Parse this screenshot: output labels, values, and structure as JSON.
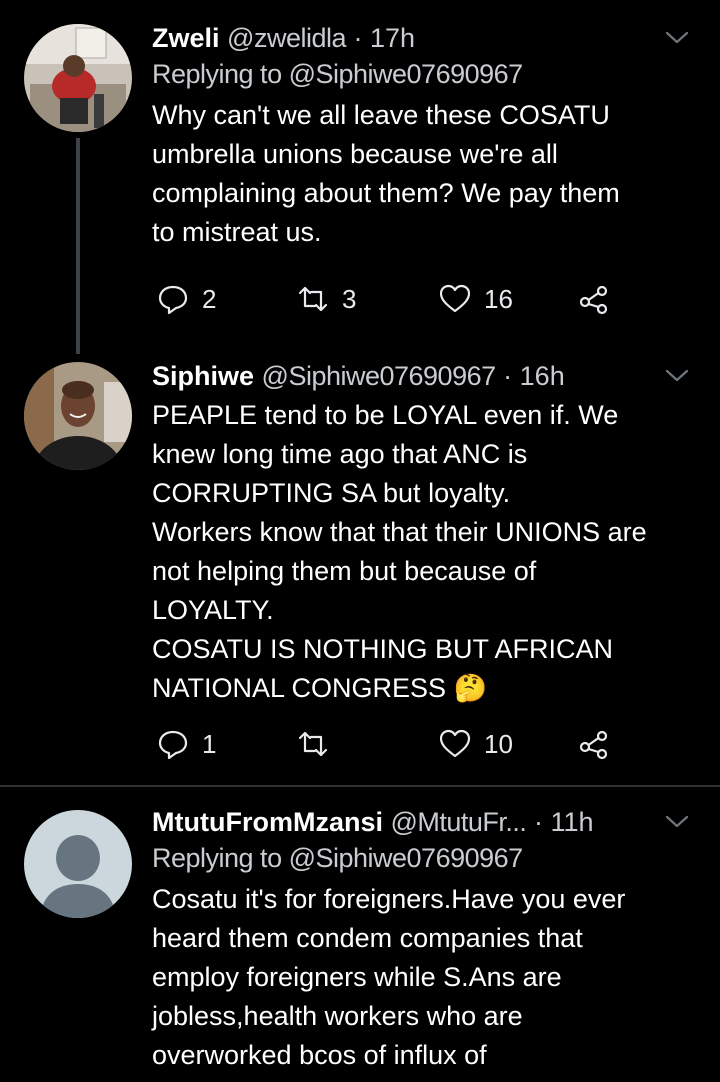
{
  "tweets": [
    {
      "name": "Zweli",
      "handle": "@zwelidla",
      "time": "17h",
      "replying": "Replying to @Siphiwe07690967",
      "lines": [
        "Why can't we all leave these COSATU",
        "umbrella unions because we're all",
        "complaining about them? We pay them",
        "to mistreat us."
      ],
      "replies": "2",
      "retweets": "3",
      "likes": "16"
    },
    {
      "name": "Siphiwe",
      "handle": "@Siphiwe07690967",
      "time": "16h",
      "lines": [
        "PEAPLE tend to be LOYAL even if. We",
        "knew long time ago that ANC is",
        "CORRUPTING SA but loyalty.",
        "Workers know that that their UNIONS are",
        "not helping them but because of",
        "LOYALTY.",
        "COSATU IS NOTHING BUT AFRICAN",
        "NATIONAL CONGRESS"
      ],
      "emoji": "🤔",
      "replies": "1",
      "retweets": "",
      "likes": "10"
    },
    {
      "name": "MtutuFromMzansi",
      "handle": "@MtutuFr...",
      "time": "11h",
      "replying": "Replying to @Siphiwe07690967",
      "lines": [
        "Cosatu it's for foreigners.Have you ever",
        "heard them condem companies that",
        "employ foreigners while S.Ans are",
        "jobless,health workers who are",
        "overworked bcos of influx of"
      ]
    }
  ],
  "separator": "·",
  "colors": {
    "background": "#000000",
    "text": "#ffffff",
    "muted": "#c9ccd0",
    "divider": "#2f3336",
    "thread_line": "#3d4249",
    "default_avatar_bg": "#ccd6dd",
    "default_avatar_fg": "#66757f"
  },
  "icons": [
    "chevron-down-icon",
    "reply-icon",
    "retweet-icon",
    "like-icon",
    "share-icon",
    "default-avatar-icon"
  ]
}
